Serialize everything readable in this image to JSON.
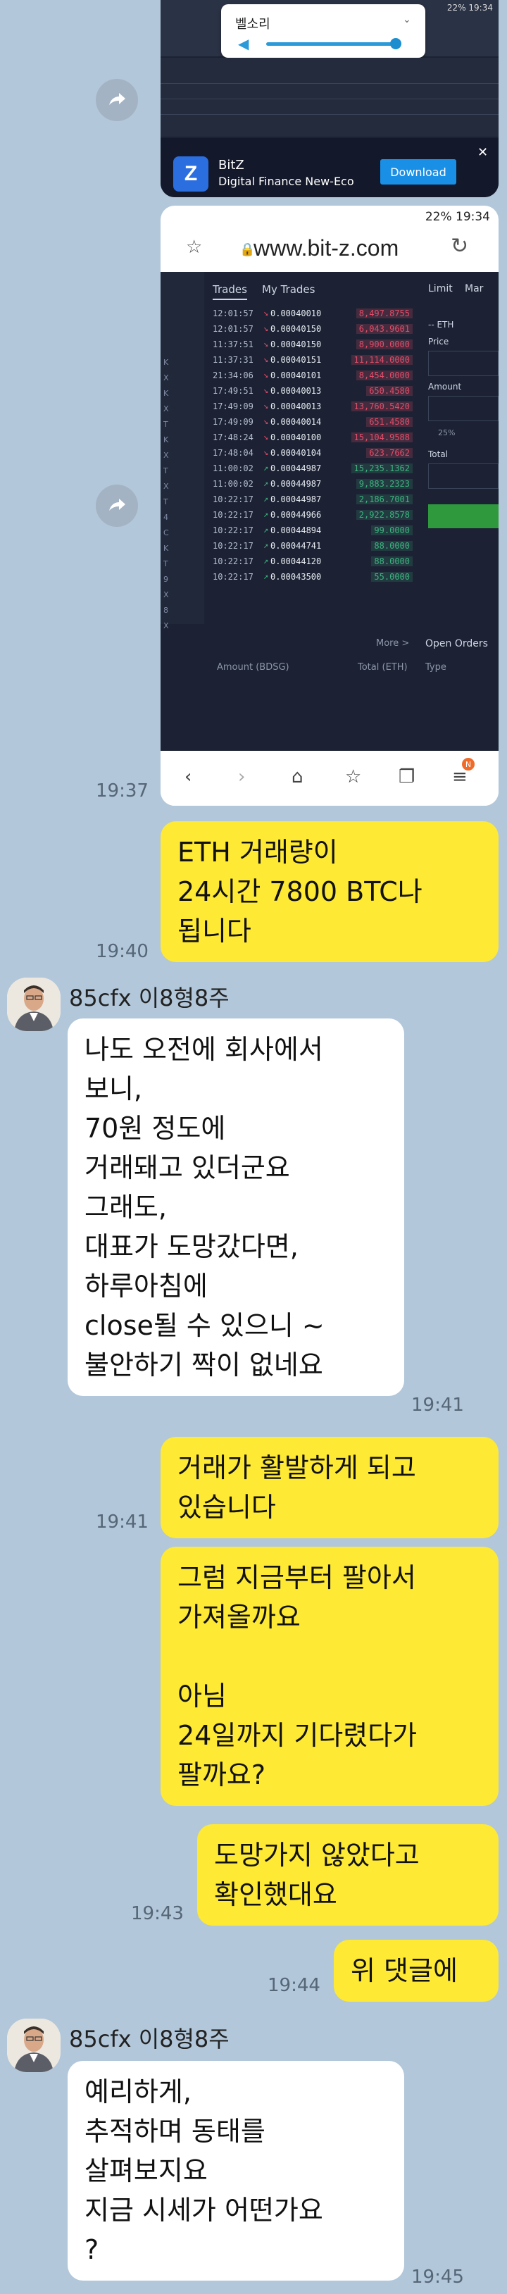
{
  "screenshot1": {
    "volume_title": "벨소리",
    "status": "22% 19:34",
    "ad": {
      "logo": "Z",
      "title": "BitZ",
      "subtitle": "Digital Finance New-Eco",
      "button": "Download"
    }
  },
  "screenshot2": {
    "status": "22% 19:34",
    "url": "www.bit-z.com",
    "tabs": [
      "Trades",
      "My Trades"
    ],
    "right_tabs": [
      "Limit",
      "Mar"
    ],
    "right_labels": {
      "pair": "-- ETH",
      "price": "Price",
      "amount": "Amount",
      "pct": "25%",
      "total": "Total"
    },
    "left_col": [
      "",
      "K",
      "X",
      "K",
      "X",
      "T",
      "K",
      "X",
      "T",
      "X",
      "T",
      "4",
      "C",
      "K",
      "T",
      "9",
      "X",
      "8",
      "X"
    ],
    "trades": [
      {
        "time": "12:01:57",
        "price": "0.00040010",
        "amount": "8,497.8755",
        "dir": "down"
      },
      {
        "time": "12:01:57",
        "price": "0.00040150",
        "amount": "6,043.9601",
        "dir": "down"
      },
      {
        "time": "11:37:51",
        "price": "0.00040150",
        "amount": "8,900.0000",
        "dir": "down"
      },
      {
        "time": "11:37:31",
        "price": "0.00040151",
        "amount": "11,114.0000",
        "dir": "down"
      },
      {
        "time": "21:34:06",
        "price": "0.00040101",
        "amount": "8,454.0000",
        "dir": "down"
      },
      {
        "time": "17:49:51",
        "price": "0.00040013",
        "amount": "650.4580",
        "dir": "down"
      },
      {
        "time": "17:49:09",
        "price": "0.00040013",
        "amount": "13,760.5420",
        "dir": "down"
      },
      {
        "time": "17:49:09",
        "price": "0.00040014",
        "amount": "651.4580",
        "dir": "down"
      },
      {
        "time": "17:48:24",
        "price": "0.00040100",
        "amount": "15,104.9588",
        "dir": "down"
      },
      {
        "time": "17:48:04",
        "price": "0.00040104",
        "amount": "623.7662",
        "dir": "down"
      },
      {
        "time": "11:00:02",
        "price": "0.00044987",
        "amount": "15,235.1362",
        "dir": "up"
      },
      {
        "time": "11:00:02",
        "price": "0.00044987",
        "amount": "9,883.2323",
        "dir": "up"
      },
      {
        "time": "10:22:17",
        "price": "0.00044987",
        "amount": "2,186.7001",
        "dir": "up"
      },
      {
        "time": "10:22:17",
        "price": "0.00044966",
        "amount": "2,922.8578",
        "dir": "up"
      },
      {
        "time": "10:22:17",
        "price": "0.00044894",
        "amount": "99.0000",
        "dir": "up"
      },
      {
        "time": "10:22:17",
        "price": "0.00044741",
        "amount": "88.0000",
        "dir": "up"
      },
      {
        "time": "10:22:17",
        "price": "0.00044120",
        "amount": "88.0000",
        "dir": "up"
      },
      {
        "time": "10:22:17",
        "price": "0.00043500",
        "amount": "55.0000",
        "dir": "up"
      }
    ],
    "more": "More >",
    "col_amount": "Amount (BDSG)",
    "col_total": "Total (ETH)",
    "open_orders": "Open Orders",
    "type": "Type",
    "badge": "N",
    "time": "19:37"
  },
  "messages": [
    {
      "id": "m1",
      "from": "me",
      "text": [
        "ETH 거래량이",
        "24시간 7800 BTC나",
        "됩니다"
      ],
      "time": "19:40"
    },
    {
      "id": "m2",
      "from": "them",
      "sender": "85cfx 이8형8주",
      "text": [
        "나도 오전에 회사에서",
        "보니,",
        "70원 정도에",
        "거래돼고 있더군요",
        "그래도,",
        "대표가 도망갔다면,",
        "하루아침에",
        "close될 수 있으니 ~",
        "불안하기 짝이 없네요"
      ],
      "time": "19:41"
    },
    {
      "id": "m3",
      "from": "me",
      "text": [
        "거래가 활발하게 되고",
        "있습니다"
      ],
      "time": "19:41"
    },
    {
      "id": "m4",
      "from": "me",
      "text": [
        "그럼 지금부터 팔아서",
        "가져올까요",
        "",
        "아님",
        "24일까지 기다렸다가",
        "팔까요?"
      ],
      "time": ""
    },
    {
      "id": "m5",
      "from": "me",
      "text": [
        "도망가지 않았다고",
        "확인했대요"
      ],
      "time": "19:43"
    },
    {
      "id": "m6",
      "from": "me",
      "text": [
        "위 댓글에"
      ],
      "time": "19:44"
    },
    {
      "id": "m7",
      "from": "them",
      "sender": "85cfx 이8형8주",
      "text": [
        "예리하게,",
        "추적하며 동태를",
        "살펴보지요",
        "지금 시세가 어떤가요",
        "?"
      ],
      "time": "19:45"
    }
  ],
  "colors": {
    "me_bubble": "#fee934",
    "them_bubble": "#ffffff",
    "bg": "#b2c7da",
    "up": "#3fb27f",
    "down": "#e04e6a"
  }
}
